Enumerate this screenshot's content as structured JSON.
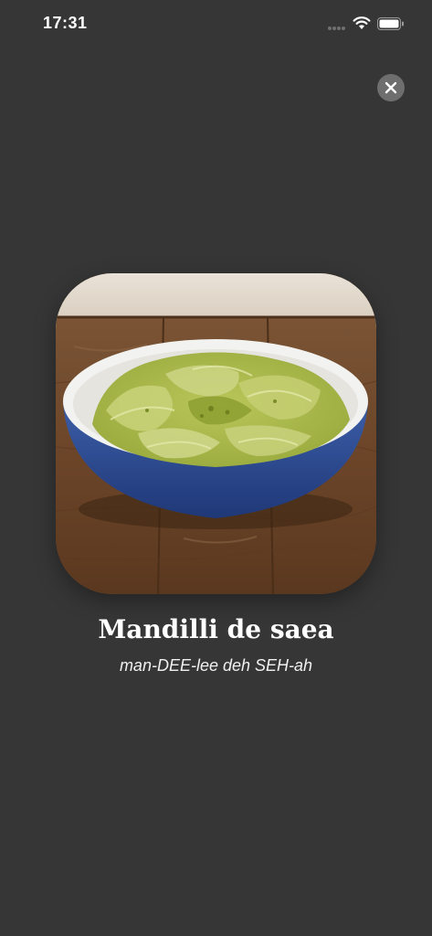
{
  "status_bar": {
    "time": "17:31"
  },
  "icons": {
    "signal": "cellular-signal-icon",
    "wifi": "wifi-icon",
    "battery": "battery-icon",
    "close": "close-icon"
  },
  "dish": {
    "name": "Mandilli de saea",
    "pronunciation": "man-DEE-lee deh SEH-ah",
    "image": "pasta-with-pesto-photo"
  },
  "colors": {
    "background": "#363636",
    "close_button": "#6e6e6e",
    "text": "#ffffff"
  }
}
